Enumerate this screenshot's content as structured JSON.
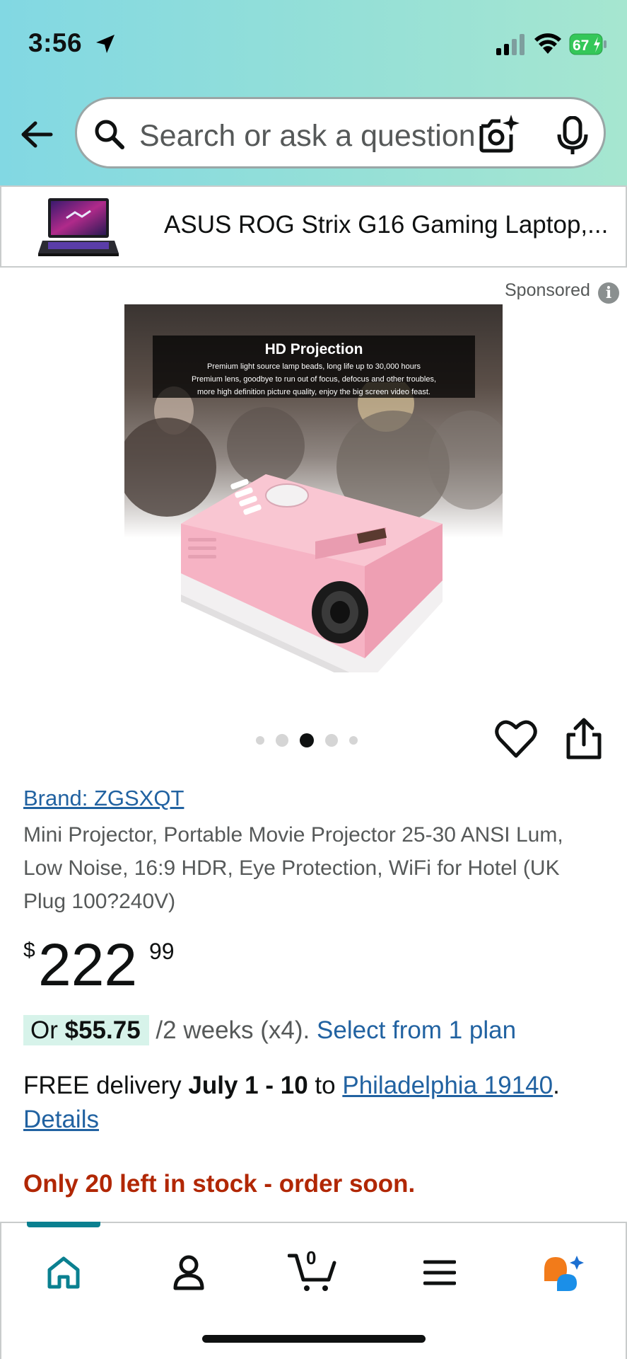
{
  "status_bar": {
    "time": "3:56",
    "battery": "67"
  },
  "search": {
    "placeholder": "Search or ask a question",
    "icons": [
      "back-arrow-icon",
      "search-icon",
      "camera-sparkle-icon",
      "microphone-icon"
    ]
  },
  "banner": {
    "product_name": "ASUS ROG Strix G16 Gaming Laptop,..."
  },
  "sponsored": {
    "label": "Sponsored",
    "info": "i"
  },
  "hero_image": {
    "heading": "HD Projection",
    "lines": [
      "Premium light source lamp beads, long life up to 30,000 hours",
      "Premium lens, goodbye to run out of focus, defocus and other troubles,",
      "more high definition picture quality, enjoy the big screen video feast."
    ]
  },
  "carousel": {
    "total": 5,
    "active": 3
  },
  "product": {
    "brand": "Brand: ZGSXQT",
    "title": "Mini Projector, Portable Movie Projector 25-30 ANSI Lum, Low Noise, 16:9 HDR, Eye Protection, WiFi for Hotel (UK Plug 100?240V)",
    "price": {
      "currency": "$",
      "whole": "222",
      "fraction": "99"
    },
    "installment": {
      "prefix": "Or",
      "amount": "$55.75",
      "terms": "/2 weeks (x4).",
      "link": "Select from 1 plan"
    },
    "delivery": {
      "prefix": "FREE delivery",
      "dates": "July 1 - 10",
      "to": "to",
      "location": "Philadelphia 19140",
      "link": "Details"
    },
    "stock": "Only 20 left in stock - order soon."
  },
  "tabbar": {
    "cart_count": "0",
    "active_tab": "home",
    "accent": "#0a8090"
  },
  "colors": {
    "link": "#2162a1",
    "stock_warning": "#b12704",
    "installment_bg": "#d7f3ea"
  }
}
